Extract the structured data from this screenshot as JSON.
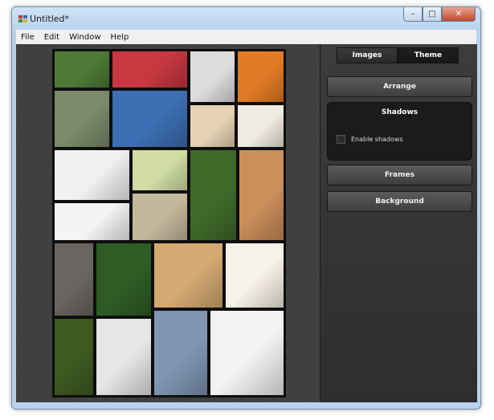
{
  "window": {
    "title": "Untitled*",
    "buttons": {
      "minimize": "–",
      "maximize": "□",
      "close": "✕"
    }
  },
  "menu": [
    "File",
    "Edit",
    "Window",
    "Help"
  ],
  "panel": {
    "tabs": [
      {
        "label": "Images",
        "active": false
      },
      {
        "label": "Theme",
        "active": true
      }
    ],
    "arrange_label": "Arrange",
    "shadows": {
      "title": "Shadows",
      "enable_label": "Enable shadows",
      "checked": false
    },
    "frames_label": "Frames",
    "background_label": "Background"
  },
  "colors": {
    "canvas": "#3c3c3c",
    "panel": "#333333",
    "accent_title_bar": "#b9d3ee"
  },
  "collage": {
    "photos": [
      {
        "name": "photo-kitten-grass",
        "color": "#4d7a36"
      },
      {
        "name": "photo-berry-cake",
        "color": "#c73840"
      },
      {
        "name": "photo-two-kittens",
        "color": "#dcdcdc"
      },
      {
        "name": "photo-sunset-silhouette",
        "color": "#e07a24"
      },
      {
        "name": "photo-cat-doorway",
        "color": "#7a8a6a"
      },
      {
        "name": "photo-ice-cream-bar",
        "color": "#3d6fb4"
      },
      {
        "name": "photo-tea-pastries",
        "color": "#e6d2b2"
      },
      {
        "name": "photo-layer-cake-slice",
        "color": "#f0ebe0"
      },
      {
        "name": "photo-husky-puppy",
        "color": "#f1f1f1"
      },
      {
        "name": "photo-bee-flower",
        "color": "#d0dca4"
      },
      {
        "name": "photo-white-orchid",
        "color": "#3f6a2a"
      },
      {
        "name": "photo-cheesecake",
        "color": "#cc8f5a"
      },
      {
        "name": "photo-guitar-neck",
        "color": "#f4f4f4"
      },
      {
        "name": "photo-elephants",
        "color": "#c3b79c"
      },
      {
        "name": "photo-cat-closeup",
        "color": "#6a6560"
      },
      {
        "name": "photo-tomatoes",
        "color": "#2d5d24"
      },
      {
        "name": "photo-calico-cat",
        "color": "#d4aa72"
      },
      {
        "name": "photo-piggy-bank",
        "color": "#f7f2e8"
      },
      {
        "name": "photo-garden-flower",
        "color": "#3d5a22"
      },
      {
        "name": "photo-sneakers",
        "color": "#e6e6e6"
      },
      {
        "name": "photo-duck-water",
        "color": "#7f96b3"
      },
      {
        "name": "photo-green-guitar",
        "color": "#f2f2f2"
      }
    ]
  }
}
